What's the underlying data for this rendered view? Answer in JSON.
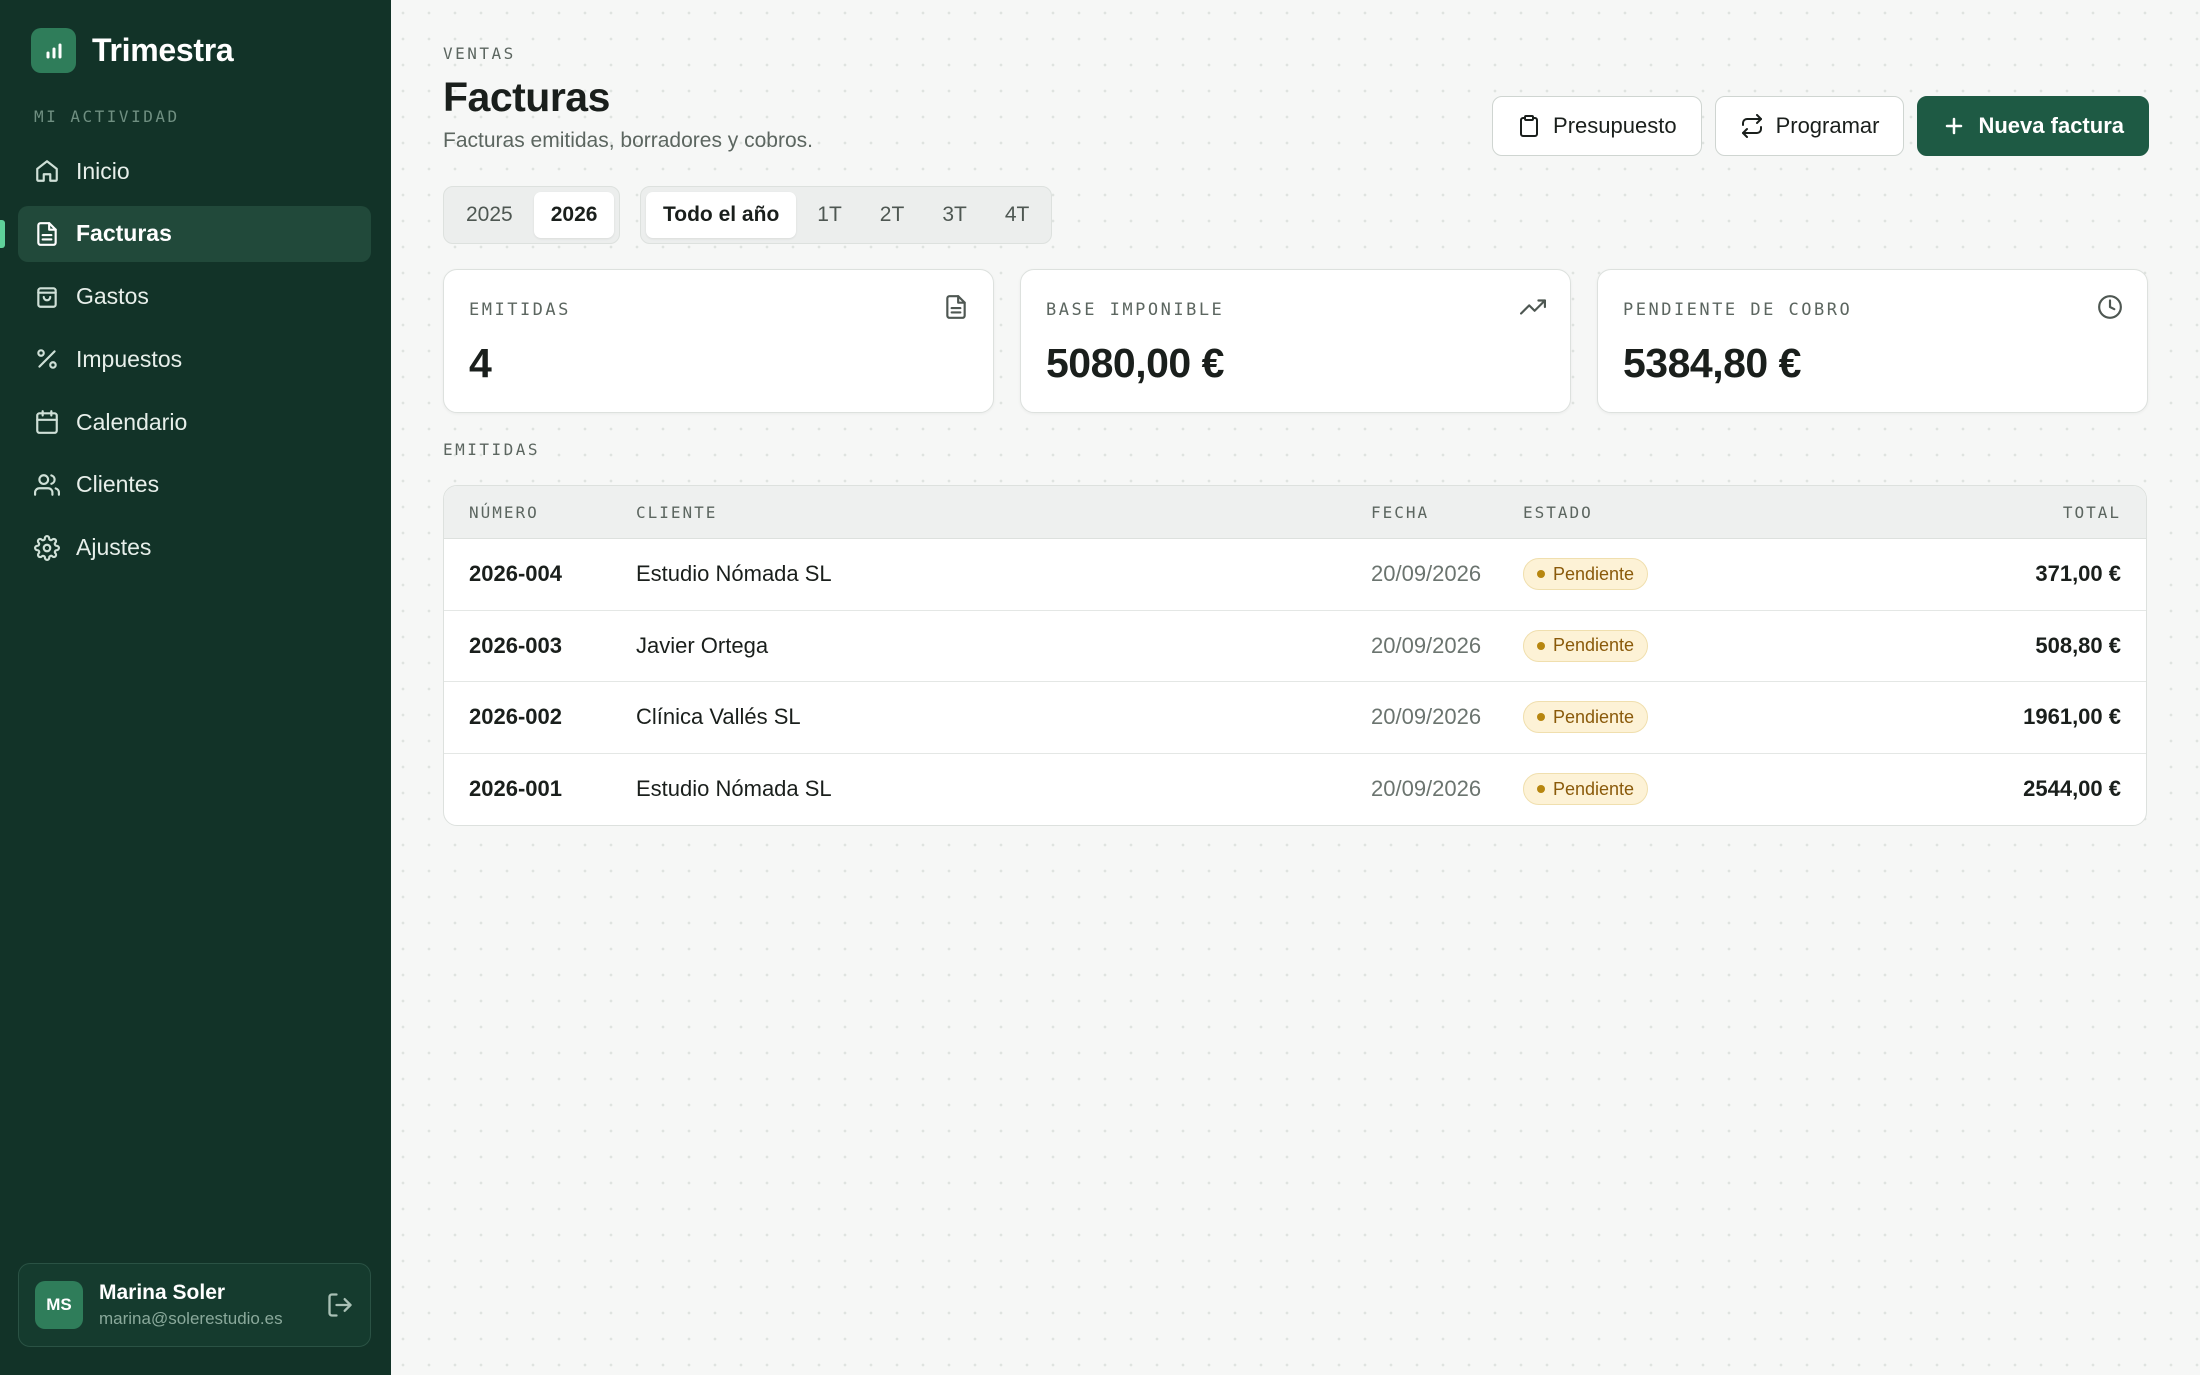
{
  "app": {
    "name": "Trimestra",
    "section_label": "MI ACTIVIDAD"
  },
  "sidebar": {
    "items": [
      {
        "label": "Inicio",
        "icon": "home-icon"
      },
      {
        "label": "Facturas",
        "icon": "file-text-icon",
        "active": true
      },
      {
        "label": "Gastos",
        "icon": "shopping-bag-icon"
      },
      {
        "label": "Impuestos",
        "icon": "percent-icon"
      },
      {
        "label": "Calendario",
        "icon": "calendar-icon"
      },
      {
        "label": "Clientes",
        "icon": "users-icon"
      },
      {
        "label": "Ajustes",
        "icon": "gear-icon"
      }
    ]
  },
  "user": {
    "initials": "MS",
    "name": "Marina Soler",
    "email": "marina@solerestudio.es"
  },
  "header": {
    "eyebrow": "VENTAS",
    "title": "Facturas",
    "subtitle": "Facturas emitidas, borradores y cobros."
  },
  "actions": {
    "quote_label": "Presupuesto",
    "schedule_label": "Programar",
    "new_label": "Nueva factura"
  },
  "years": {
    "options": [
      "2025",
      "2026"
    ],
    "selected": "2026"
  },
  "periods": {
    "options": [
      "Todo el año",
      "1T",
      "2T",
      "3T",
      "4T"
    ],
    "selected": "Todo el año"
  },
  "stats": [
    {
      "label": "EMITIDAS",
      "value": "4",
      "icon": "file-icon"
    },
    {
      "label": "BASE IMPONIBLE",
      "value": "5080,00 €",
      "icon": "trending-up-icon"
    },
    {
      "label": "PENDIENTE DE COBRO",
      "value": "5384,80 €",
      "icon": "clock-icon"
    }
  ],
  "table": {
    "label": "EMITIDAS",
    "columns": {
      "number": "NÚMERO",
      "client": "CLIENTE",
      "date": "FECHA",
      "state": "ESTADO",
      "total": "TOTAL"
    },
    "rows": [
      {
        "number": "2026-004",
        "client": "Estudio Nómada SL",
        "date": "20/09/2026",
        "state": "Pendiente",
        "total": "371,00 €"
      },
      {
        "number": "2026-003",
        "client": "Javier Ortega",
        "date": "20/09/2026",
        "state": "Pendiente",
        "total": "508,80 €"
      },
      {
        "number": "2026-002",
        "client": "Clínica Vallés SL",
        "date": "20/09/2026",
        "state": "Pendiente",
        "total": "1961,00 €"
      },
      {
        "number": "2026-001",
        "client": "Estudio Nómada SL",
        "date": "20/09/2026",
        "state": "Pendiente",
        "total": "2544,00 €"
      }
    ]
  },
  "colors": {
    "sidebar_bg": "#123328",
    "accent": "#1e5a44",
    "active_indicator": "#5fd19a",
    "badge_pending_bg": "#fdf2d6",
    "badge_pending_text": "#8a5a0a"
  }
}
